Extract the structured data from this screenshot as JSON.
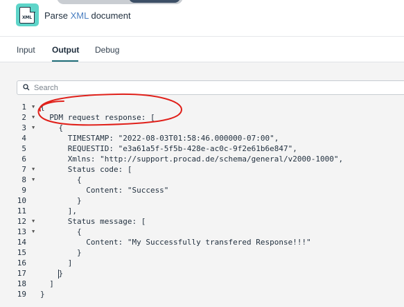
{
  "header": {
    "icon_label": "XML",
    "title_prefix": "Parse",
    "title_accent": "XML",
    "title_suffix": "document"
  },
  "tabs": [
    {
      "label": "Input",
      "active": false
    },
    {
      "label": "Output",
      "active": true
    },
    {
      "label": "Debug",
      "active": false
    }
  ],
  "search": {
    "placeholder": "Search",
    "value": ""
  },
  "editor": {
    "lines": [
      {
        "n": "1",
        "text": "{"
      },
      {
        "n": "2",
        "text": "  PDM request response: ["
      },
      {
        "n": "3",
        "text": "    {"
      },
      {
        "n": "4",
        "text": "      TIMESTAMP: \"2022-08-03T01:58:46.000000-07:00\","
      },
      {
        "n": "5",
        "text": "      REQUESTID: \"e3a61a5f-5f5b-428e-ac0c-9f2e61b6e847\","
      },
      {
        "n": "6",
        "text": "      Xmlns: \"http://support.procad.de/schema/general/v2000-1000\","
      },
      {
        "n": "7",
        "text": "      Status code: ["
      },
      {
        "n": "8",
        "text": "        {"
      },
      {
        "n": "9",
        "text": "          Content: \"Success\""
      },
      {
        "n": "10",
        "text": "        }"
      },
      {
        "n": "11",
        "text": "      ],"
      },
      {
        "n": "12",
        "text": "      Status message: ["
      },
      {
        "n": "13",
        "text": "        {"
      },
      {
        "n": "14",
        "text": "          Content: \"My Successfully transfered Response!!!\""
      },
      {
        "n": "15",
        "text": "        }"
      },
      {
        "n": "16",
        "text": "      ]"
      },
      {
        "n": "17",
        "text": "    }"
      },
      {
        "n": "18",
        "text": "  ]"
      },
      {
        "n": "19",
        "text": "}"
      }
    ],
    "fold_lines": [
      "1",
      "2",
      "3",
      "7",
      "8",
      "12",
      "13"
    ]
  },
  "colors": {
    "accent": "#4a7fc1",
    "tab_underline": "#1f6d78",
    "icon_bg": "#5ed5c9",
    "annotation": "#e0201a"
  },
  "icons": {
    "app": "xml-document-icon",
    "search": "search-icon",
    "fold": "fold-arrow-icon"
  }
}
